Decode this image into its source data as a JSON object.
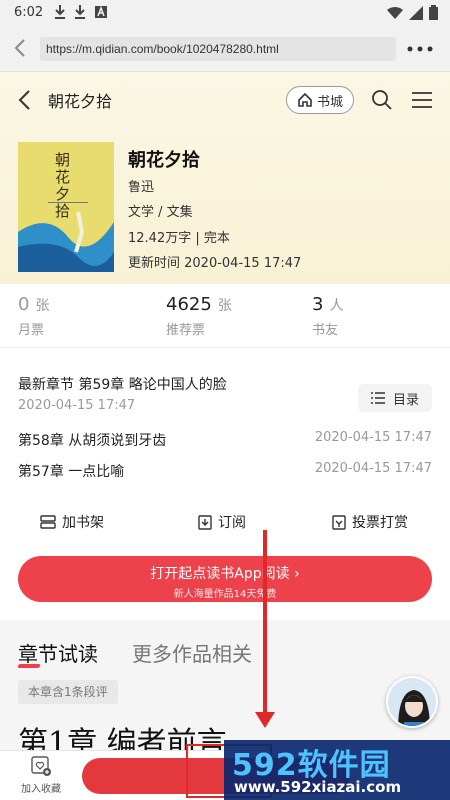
{
  "status_bar": {
    "time": "6:02"
  },
  "browser": {
    "url": "https://m.qidian.com/book/1020478280.html"
  },
  "topnav": {
    "title": "朝花夕拾",
    "home_label": "书城"
  },
  "book": {
    "title": "朝花夕拾",
    "author": "鲁迅",
    "genre": "文学 / 文集",
    "words_status": "12.42万字 | 完本",
    "updated": "更新时间 2020-04-15 17:47",
    "cover_title": "朝花夕拾"
  },
  "stats": [
    {
      "value": "0",
      "unit": "张",
      "label": "月票"
    },
    {
      "value": "4625",
      "unit": "张",
      "label": "推荐票"
    },
    {
      "value": "3",
      "unit": "人",
      "label": "书友"
    }
  ],
  "latest": {
    "text": "最新章节 第59章 略论中国人的脸",
    "date": "2020-04-15 17:47",
    "toc_label": "目录"
  },
  "chapters": [
    {
      "title": "第58章 从胡须说到牙齿",
      "date": "2020-04-15 17:47"
    },
    {
      "title": "第57章 一点比喻",
      "date": "2020-04-15 17:47"
    }
  ],
  "actions": {
    "shelf": "加书架",
    "subscribe": "订阅",
    "vote": "投票打赏"
  },
  "open_app": {
    "main": "打开起点读书App阅读 ›",
    "sub": "新人海量作品14天免费"
  },
  "section": {
    "tab_active": "章节试读",
    "tab_other": "更多作品相关",
    "tag": "本章含1条段评",
    "chapter_heading": "第1章 编者前言"
  },
  "bottom": {
    "fav_label": "加入收藏"
  },
  "watermark": {
    "big": "592软件园",
    "small": "www.592xiazai.com"
  },
  "colors": {
    "accent": "#ed424b",
    "hero_bg": "#fbf7e4"
  }
}
